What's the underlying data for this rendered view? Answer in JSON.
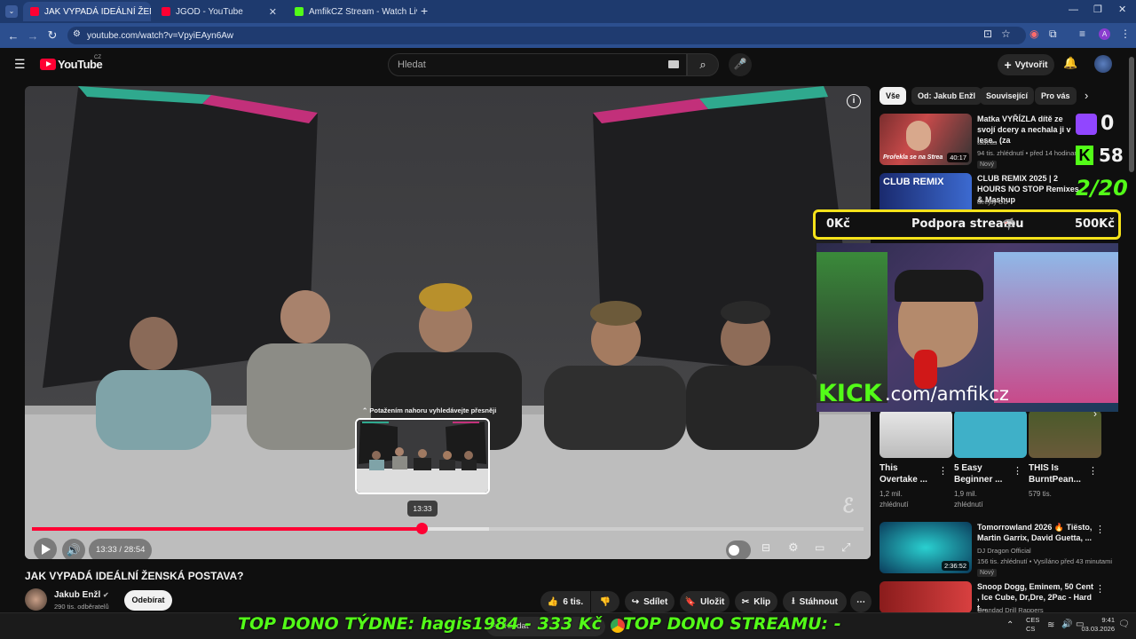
{
  "tabs": [
    {
      "title": "JAK VYPADÁ IDEÁLNÍ ŽENSKÁ",
      "active": true
    },
    {
      "title": "JGOD - YouTube",
      "active": false
    },
    {
      "title": "AmfikCZ Stream - Watch Live o",
      "active": false
    }
  ],
  "new_tab": "+",
  "browser": {
    "url": "youtube.com/watch?v=VpyiEAyn6Aw"
  },
  "youtube": {
    "logo": "YouTube",
    "country": "CZ",
    "search_placeholder": "Hledat",
    "create_label": "Vytvořit",
    "filters": [
      "Vše",
      "Od: Jakub Enžl",
      "Související",
      "Pro vás"
    ]
  },
  "player": {
    "seek_hint": "⌃ Potažením nahoru vyhledávejte přesněji",
    "preview_time": "13:33",
    "time": "13:33 / 28:54",
    "progress": 0.469,
    "buffered": 0.55
  },
  "video": {
    "title": "JAK VYPADÁ IDEÁLNÍ ŽENSKÁ POSTAVA?",
    "channel": "Jakub Enžl",
    "subscribers": "290 tis. odběratelů",
    "subscribe_label": "Odebírat",
    "likes": "6 tis.",
    "share_label": "Sdílet",
    "save_label": "Uložit",
    "clip_label": "Klip",
    "download_label": "Stáhnout"
  },
  "recommended": [
    {
      "title": "Matka VYŘÍZLA dítě ze svojí dcery a nechala ji v lese.. (za",
      "channel": "tadeas",
      "meta": "94 tis. zhlédnutí • před 14 hodinami",
      "badge": "Nový",
      "duration": "40:17",
      "thumb_text": "Prořekla se na Strea"
    },
    {
      "title": "CLUB REMIX 2025 | 2 HOURS NO STOP Remixes & Mashup",
      "channel": "deejay DD",
      "thumb_text": "CLUB REMIX"
    },
    {
      "title": "Tomorrowland 2026 🔥 Tiësto, Martin Garrix, David Guetta, ...",
      "channel": "DJ Dragon Official",
      "meta": "156 tis. zhlédnutí • Vysíláno před 43 minutami",
      "badge": "Nový",
      "duration": "2:36:52"
    },
    {
      "title": "Snoop Dogg, Eminem, 50 Cent , Ice Cube, Dr,Dre, 2Pac - Hard t...",
      "channel": "Grandad Drill Rappers"
    }
  ],
  "shorts": [
    {
      "title": "This Overtake ...",
      "views": "1,2 mil. zhlédnutí"
    },
    {
      "title": "5 Easy Beginner ...",
      "views": "1,9 mil. zhlédnutí"
    },
    {
      "title": "THIS Is BurntPean...",
      "views": "579 tis."
    }
  ],
  "stream_overlay": {
    "twitch_count": "0",
    "kick_count": "58",
    "goal": "2/20",
    "donation_left": "0Kč",
    "donation_title": "Podpora streamu",
    "donation_right": "500Kč",
    "kick_brand": "KICK",
    "kick_url": ".com/amfikcz",
    "top_week": "TOP DONO TÝDNE:  hagis1984 - 333 Kč",
    "top_stream": "TOP DONO STREAMU: -"
  },
  "taskbar": {
    "search": "Hledat",
    "lang": "CES\nCS",
    "time": "9:41",
    "date": "03.03.2026"
  },
  "colors": {
    "accent_red": "#ff0033",
    "kick_green": "#53fc18",
    "browser_blue": "#2c4f8f"
  }
}
